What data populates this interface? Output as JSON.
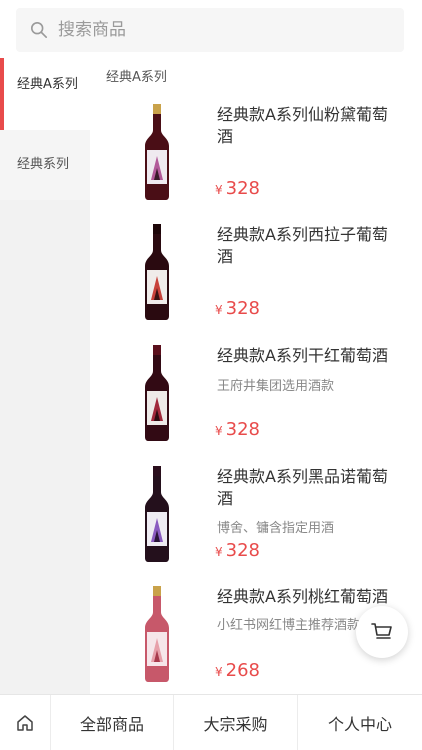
{
  "search": {
    "placeholder": "搜索商品"
  },
  "sidebar": {
    "items": [
      {
        "label": "经典A系列"
      },
      {
        "label": "经典系列"
      }
    ]
  },
  "section_title": "经典A系列",
  "products": [
    {
      "name": "经典款A系列仙粉黛葡萄酒",
      "desc": "",
      "currency": "¥",
      "price": "328",
      "bottle_color": "#4a0e16",
      "label_accent": "#b35a9a"
    },
    {
      "name": "经典款A系列西拉子葡萄酒",
      "desc": "",
      "currency": "¥",
      "price": "328",
      "bottle_color": "#2a0a10",
      "label_accent": "#c8423b"
    },
    {
      "name": "经典款A系列干红葡萄酒",
      "desc": "王府井集团选用酒款",
      "currency": "¥",
      "price": "328",
      "bottle_color": "#320a14",
      "label_accent": "#a0283b"
    },
    {
      "name": "经典款A系列黑品诺葡萄酒",
      "desc": "博舍、镛含指定用酒",
      "currency": "¥",
      "price": "328",
      "bottle_color": "#24101c",
      "label_accent": "#8a5bc0"
    },
    {
      "name": "经典款A系列桃红葡萄酒",
      "desc": "小红书网红博主推荐酒款",
      "currency": "¥",
      "price": "268",
      "bottle_color": "#c7586a",
      "label_accent": "#e7a0aa"
    }
  ],
  "bottom_nav": {
    "tabs": [
      "全部商品",
      "大宗采购",
      "个人中心"
    ]
  },
  "colors": {
    "accent": "#e84b4b",
    "price": "#e84b4b"
  }
}
